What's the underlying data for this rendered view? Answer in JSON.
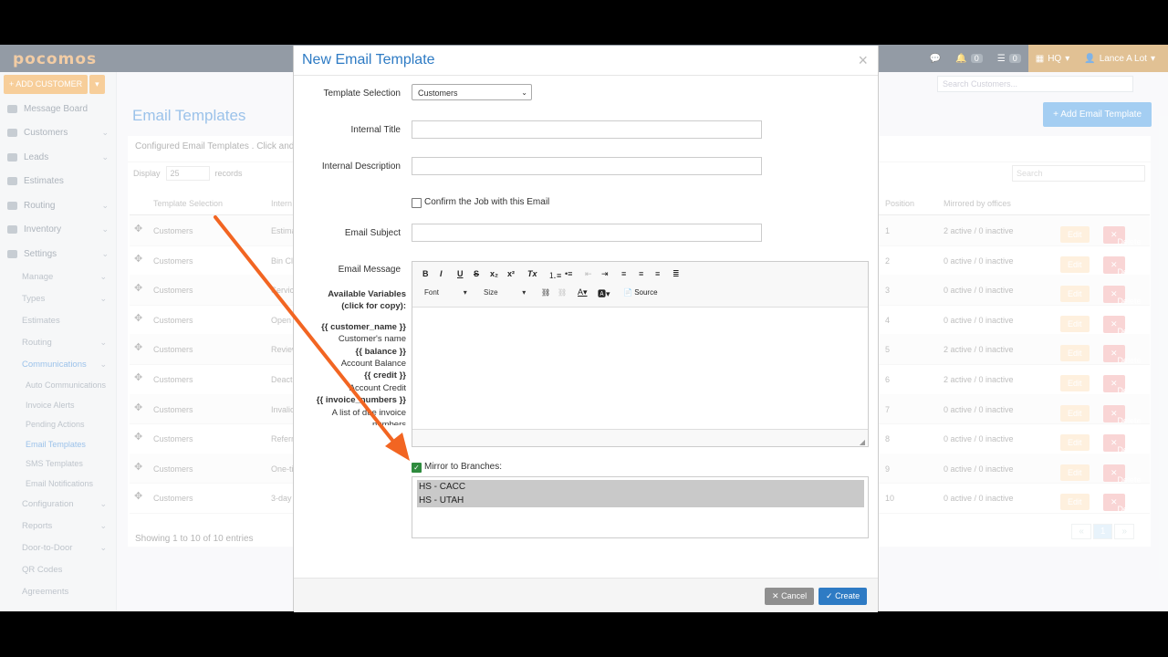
{
  "app": {
    "logo": "pocomos"
  },
  "topbar": {
    "chat_count": "",
    "bell_count": "0",
    "list_count": "0",
    "office": "HQ",
    "user": "Lance A Lot"
  },
  "sidebar": {
    "add_customer": "ADD CUSTOMER",
    "items": [
      {
        "label": "Message Board"
      },
      {
        "label": "Customers"
      },
      {
        "label": "Leads"
      },
      {
        "label": "Estimates"
      },
      {
        "label": "Routing"
      },
      {
        "label": "Inventory"
      },
      {
        "label": "Settings"
      }
    ],
    "settings_sub": [
      {
        "label": "Manage"
      },
      {
        "label": "Types"
      },
      {
        "label": "Estimates"
      },
      {
        "label": "Routing"
      },
      {
        "label": "Communications"
      }
    ],
    "comm_sub": [
      {
        "label": "Auto Communications"
      },
      {
        "label": "Invoice Alerts"
      },
      {
        "label": "Pending Actions"
      },
      {
        "label": "Email Templates"
      },
      {
        "label": "SMS Templates"
      },
      {
        "label": "Email Notifications"
      }
    ],
    "more_sub": [
      {
        "label": "Configuration"
      },
      {
        "label": "Reports"
      },
      {
        "label": "Door-to-Door"
      },
      {
        "label": "QR Codes"
      },
      {
        "label": "Agreements"
      }
    ]
  },
  "page": {
    "title": "Email Templates",
    "search_placeholder": "Search Customers...",
    "add_button": "Add Email Template",
    "panel_header": "Configured Email Templates . Click and",
    "display_label": "Display",
    "display_value": "25",
    "records_label": "records",
    "table_search": "Search",
    "columns": {
      "c1": "Template Selection",
      "c2": "Intern",
      "c3": "Position",
      "c4": "Mirrored by offices"
    },
    "rows": [
      {
        "sel": "Customers",
        "title": "Estima",
        "pos": "1",
        "mir": "2 active / 0 inactive"
      },
      {
        "sel": "Customers",
        "title": "Bin Cle",
        "pos": "2",
        "mir": "0 active / 0 inactive"
      },
      {
        "sel": "Customers",
        "title": "Service",
        "pos": "3",
        "mir": "0 active / 0 inactive"
      },
      {
        "sel": "Customers",
        "title": "Open",
        "pos": "4",
        "mir": "0 active / 0 inactive"
      },
      {
        "sel": "Customers",
        "title": "Review",
        "pos": "5",
        "mir": "2 active / 0 inactive"
      },
      {
        "sel": "Customers",
        "title": "Deacti",
        "pos": "6",
        "mir": "2 active / 0 inactive"
      },
      {
        "sel": "Customers",
        "title": "Invalic",
        "pos": "7",
        "mir": "0 active / 0 inactive"
      },
      {
        "sel": "Customers",
        "title": "Referr",
        "pos": "8",
        "mir": "0 active / 0 inactive"
      },
      {
        "sel": "Customers",
        "title": "One-ti",
        "pos": "9",
        "mir": "0 active / 0 inactive"
      },
      {
        "sel": "Customers",
        "title": "3-day",
        "pos": "10",
        "mir": "0 active / 0 inactive"
      }
    ],
    "edit_label": "Edit",
    "delete_label": "Delete",
    "showing": "Showing 1 to 10 of 10 entries",
    "pager": {
      "prev": "«",
      "cur": "1",
      "next": "»"
    }
  },
  "modal": {
    "title": "New Email Template",
    "close": "×",
    "template_selection_label": "Template Selection",
    "template_selection_value": "Customers",
    "internal_title_label": "Internal Title",
    "internal_description_label": "Internal Description",
    "confirm_job_label": "Confirm the Job with this Email",
    "email_subject_label": "Email Subject",
    "email_message_label": "Email Message",
    "available_vars_label": "Available Variables",
    "click_copy": "(click for copy):",
    "variables": [
      {
        "code": "{{ customer_name }}",
        "desc": "Customer's name"
      },
      {
        "code": "{{ balance }}",
        "desc": "Account Balance"
      },
      {
        "code": "{{ credit }}",
        "desc": "Account Credit"
      },
      {
        "code": "{{ invoice_numbers }}",
        "desc": "A list of due invoice numbers"
      }
    ],
    "toolbar": {
      "font": "Font",
      "size": "Size",
      "source": "Source"
    },
    "mirror_label": "Mirror to Branches:",
    "branches": [
      {
        "label": "HS - CACC"
      },
      {
        "label": "HS - UTAH"
      }
    ],
    "cancel": "Cancel",
    "create": "Create"
  },
  "colors": {
    "accent": "#2e7bc4",
    "annotation_arrow": "#f26522",
    "brand": "#f0a647"
  }
}
